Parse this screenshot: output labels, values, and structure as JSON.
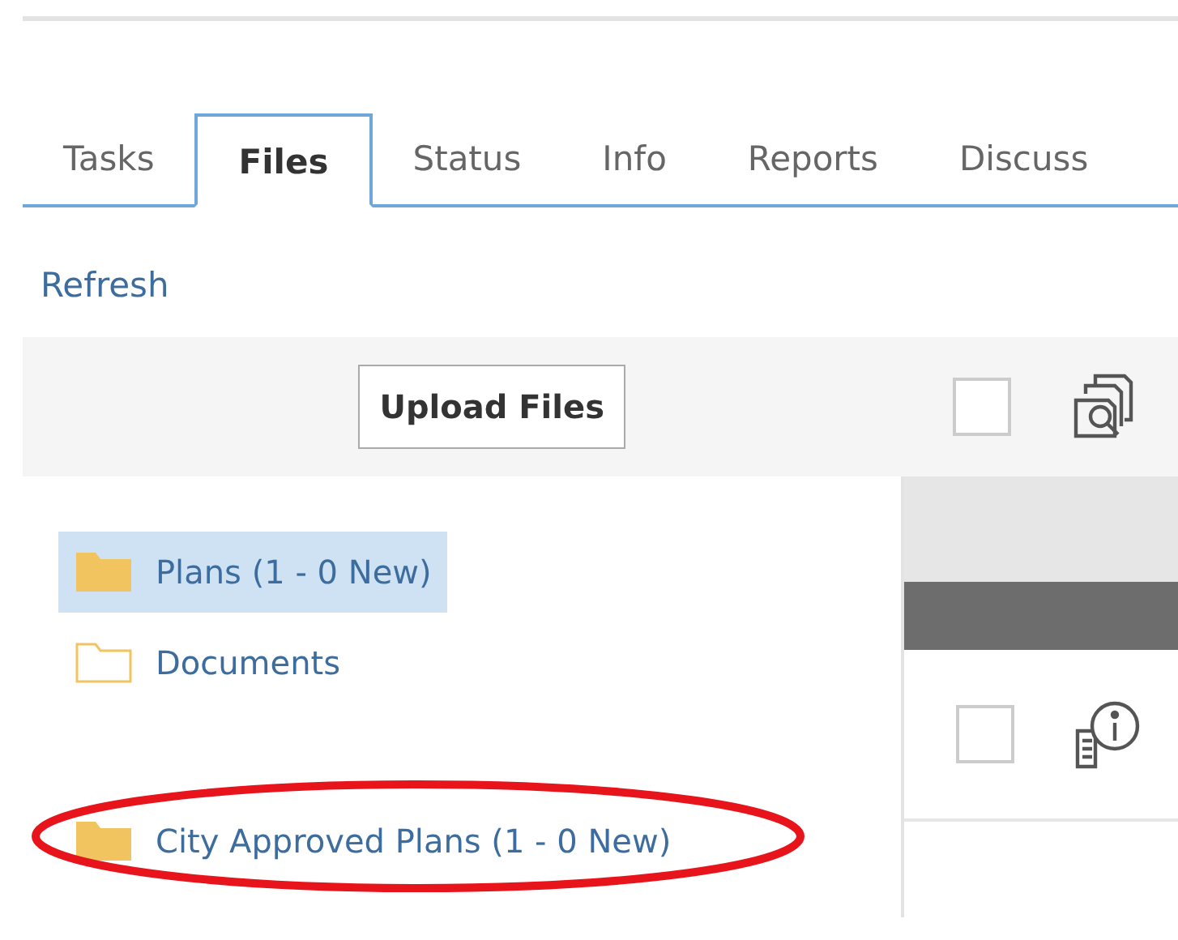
{
  "tabs": [
    {
      "label": "Tasks",
      "selected": false
    },
    {
      "label": "Files",
      "selected": true
    },
    {
      "label": "Status",
      "selected": false
    },
    {
      "label": "Info",
      "selected": false
    },
    {
      "label": "Reports",
      "selected": false
    },
    {
      "label": "Discuss",
      "selected": false
    }
  ],
  "refresh_link": "Refresh",
  "toolbar": {
    "upload_button": "Upload Files",
    "select_all_checked": false
  },
  "folders": [
    {
      "label": "Plans (1 - 0 New)",
      "selected": true,
      "has_files": true,
      "highlighted": false
    },
    {
      "label": "Documents",
      "selected": false,
      "has_files": false,
      "highlighted": false
    },
    {
      "label": "City Approved Plans (1 - 0 New)",
      "selected": false,
      "has_files": true,
      "highlighted": true
    }
  ],
  "file_rows": [
    {
      "checked": false
    }
  ]
}
